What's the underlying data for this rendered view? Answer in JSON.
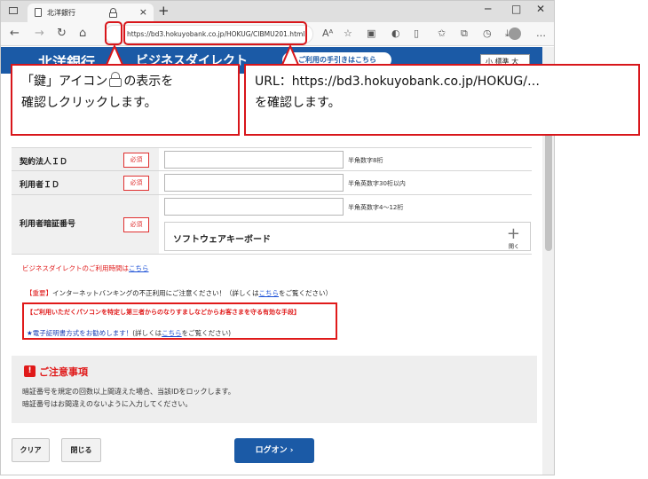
{
  "browser": {
    "tab_title": "北洋銀行",
    "url": "https://bd3.hokuyobank.co.jp/HOKUG/CIBMU201.html"
  },
  "bank": {
    "name": "北洋銀行",
    "service": "ビジネスダイレクト",
    "help_link": "ご利用の手引きはこちら",
    "font_size_label": "小 標準 大"
  },
  "form": {
    "rows": [
      {
        "label": "契約法人ＩＤ",
        "required": "必須",
        "hint": "半角数字8桁"
      },
      {
        "label": "利用者ＩＤ",
        "required": "必須",
        "hint": "半角英数字30桁以内"
      },
      {
        "label": "利用者暗証番号",
        "required": "必須",
        "hint": "半角英数字4～12桁"
      }
    ],
    "software_keyboard": "ソフトウェアキーボード",
    "keyboard_open": "開く"
  },
  "notices": {
    "hours_text": "ビジネスダイレクトのご利用時間は",
    "hours_link": "こちら",
    "important_tag": "【重要】",
    "important_text": "インターネットバンキングの不正利用にご注意ください！（詳しくは",
    "important_link": "こちら",
    "important_tail": "をご覧ください）",
    "fraud_heading": "【ご利用いただくパソコンを特定し第三者からのなりすましなどからお客さまを守る有効な手段】",
    "cert_text": "★電子証明書方式をお勧めします！",
    "cert_more": "(詳しくは",
    "cert_link": "こちら",
    "cert_tail": "をご覧ください)"
  },
  "caution": {
    "heading": "ご注意事項",
    "line1": "暗証番号を規定の回数以上間違えた場合、当該IDをロックします。",
    "line2": "暗証番号はお間違えのないように入力してください。"
  },
  "buttons": {
    "clear": "クリア",
    "close": "閉じる",
    "logon": "ログオン ›"
  },
  "callouts": {
    "lock_line1a": "「鍵」アイコン",
    "lock_line1b": "の表示を",
    "lock_line2": "確認しクリックします。",
    "url_line1": "URL：https://bd3.hokuyobank.co.jp/HOKUG/…",
    "url_line2": "を確認します。"
  }
}
